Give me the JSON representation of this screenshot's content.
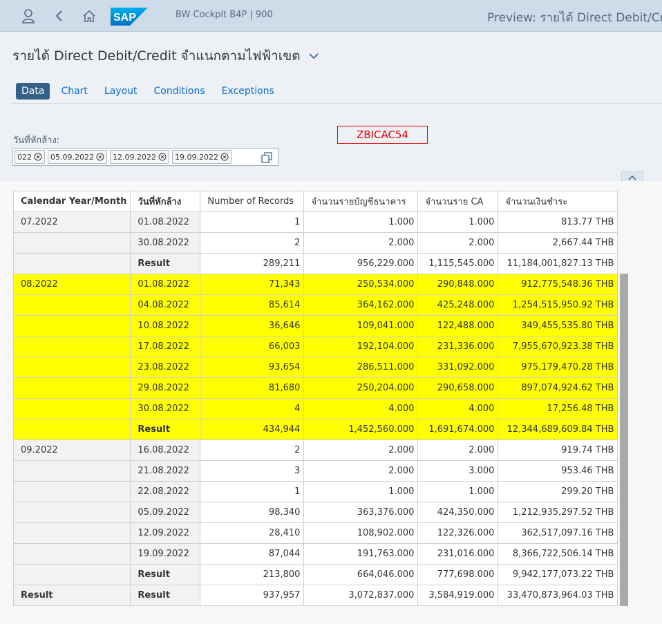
{
  "shell": {
    "app_title": "BW Cockpit B4P | 900",
    "preview_title": "Preview: รายได้ Direct Debit/Credi"
  },
  "page": {
    "title": "รายได้ Direct Debit/Credit จำแนกตามไฟฟ้าเขต",
    "tabs": [
      "Data",
      "Chart",
      "Layout",
      "Conditions",
      "Exceptions"
    ],
    "active_tab": "Data"
  },
  "filter": {
    "label": "วันที่หักล้าง:",
    "tokens": [
      "022",
      "05.09.2022",
      "12.09.2022",
      "19.09.2022"
    ]
  },
  "tech_name": "ZBICAC54",
  "colors": {
    "highlight": "#ffff00",
    "shell": "#cfdbe9",
    "tech_name": "#e60000"
  },
  "table": {
    "headers": [
      "Calendar Year/Month",
      "วันที่หักล้าง",
      "Number of Records",
      "จำนวนรายบัญชีธนาคาร",
      "จำนวนราย CA",
      "จำนวนเงินชำระ"
    ],
    "rows": [
      [
        "07.2022",
        "01.08.2022",
        "1",
        "1.000",
        "1.000",
        "813.77 THB"
      ],
      [
        "",
        "30.08.2022",
        "2",
        "2.000",
        "2.000",
        "2,667.44 THB"
      ],
      [
        "",
        "Result",
        "289,211",
        "956,229.000",
        "1,115,545.000",
        "11,184,001,827.13 THB"
      ],
      [
        "08.2022",
        "01.08.2022",
        "71,343",
        "250,534.000",
        "290,848.000",
        "912,775,548.36 THB"
      ],
      [
        "",
        "04.08.2022",
        "85,614",
        "364,162.000",
        "425,248.000",
        "1,254,515,950.92 THB"
      ],
      [
        "",
        "10.08.2022",
        "36,646",
        "109,041.000",
        "122,488.000",
        "349,455,535.80 THB"
      ],
      [
        "",
        "17.08.2022",
        "66,003",
        "192,104.000",
        "231,336.000",
        "7,955,670,923.38 THB"
      ],
      [
        "",
        "23.08.2022",
        "93,654",
        "286,511.000",
        "331,092.000",
        "975,179,470.28 THB"
      ],
      [
        "",
        "29.08.2022",
        "81,680",
        "250,204.000",
        "290,658.000",
        "897,074,924.62 THB"
      ],
      [
        "",
        "30.08.2022",
        "4",
        "4.000",
        "4.000",
        "17,256.48 THB"
      ],
      [
        "",
        "Result",
        "434,944",
        "1,452,560.000",
        "1,691,674.000",
        "12,344,689,609.84 THB"
      ],
      [
        "09.2022",
        "16.08.2022",
        "2",
        "2.000",
        "2.000",
        "919.74 THB"
      ],
      [
        "",
        "21.08.2022",
        "3",
        "2.000",
        "3.000",
        "953.46 THB"
      ],
      [
        "",
        "22.08.2022",
        "1",
        "1.000",
        "1.000",
        "299.20 THB"
      ],
      [
        "",
        "05.09.2022",
        "98,340",
        "363,376.000",
        "424,350.000",
        "1,212,935,297.52 THB"
      ],
      [
        "",
        "12.09.2022",
        "28,410",
        "108,902.000",
        "122,326.000",
        "362,517,097.16 THB"
      ],
      [
        "",
        "19.09.2022",
        "87,044",
        "191,763.000",
        "231,016.000",
        "8,366,722,506.14 THB"
      ],
      [
        "",
        "Result",
        "213,800",
        "664,046.000",
        "777,698.000",
        "9,942,177,073.22 THB"
      ],
      [
        "Result",
        "Result",
        "937,957",
        "3,072,837.000",
        "3,584,919.000",
        "33,470,873,964.03 THB"
      ]
    ],
    "highlighted_rows": [
      3,
      4,
      5,
      6,
      7,
      8,
      9,
      10
    ]
  }
}
